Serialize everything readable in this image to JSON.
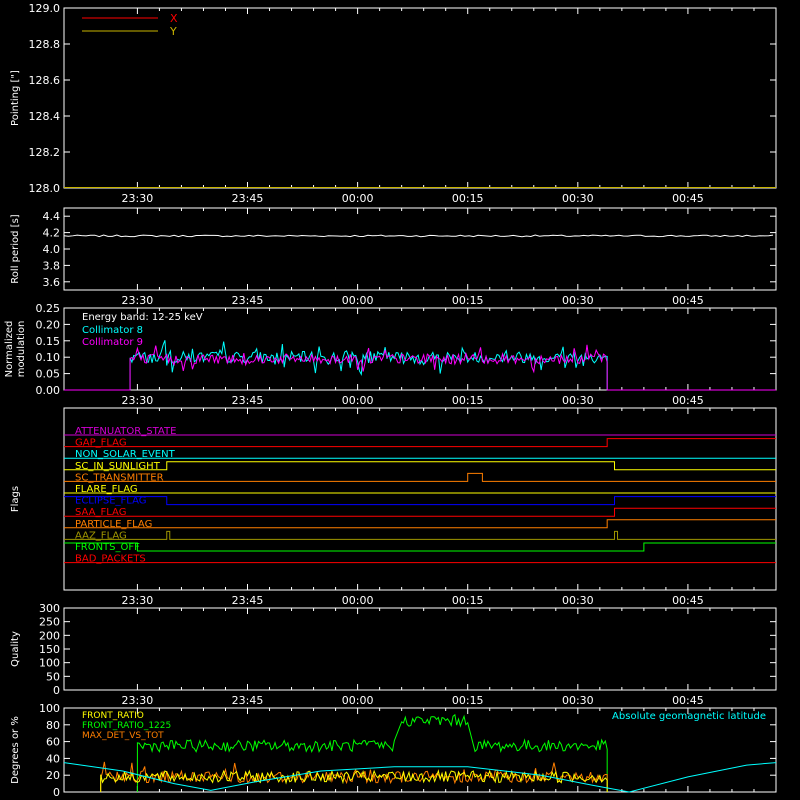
{
  "time_ticks": [
    "23:30",
    "23:45",
    "00:00",
    "00:15",
    "00:30",
    "00:45"
  ],
  "chart_data": [
    {
      "panel": "pointing",
      "type": "line",
      "ylabel": "Pointing [\"]",
      "ylim": [
        128.0,
        129.0
      ],
      "yticks": [
        "128.0",
        "128.2",
        "128.4",
        "128.6",
        "128.8",
        "129.0"
      ],
      "legend": [
        {
          "label": "X",
          "color": "#ff0000"
        },
        {
          "label": "Y",
          "color": "#c8b400"
        }
      ],
      "series": [
        {
          "name": "X",
          "color": "#ff0000",
          "points": [
            [
              "23:20",
              128.0
            ],
            [
              "00:57",
              128.0
            ]
          ]
        },
        {
          "name": "Y",
          "color": "#c8b400",
          "points": [
            [
              "23:20",
              128.0
            ],
            [
              "00:57",
              128.0
            ]
          ]
        }
      ]
    },
    {
      "panel": "roll",
      "type": "line",
      "ylabel": "Roll period [s]",
      "ylim": [
        3.5,
        4.5
      ],
      "yticks": [
        "3.6",
        "3.8",
        "4.0",
        "4.2",
        "4.4"
      ],
      "series": [
        {
          "color": "#ffffff",
          "points": [
            [
              "23:20",
              4.16
            ],
            [
              "23:40",
              4.15
            ],
            [
              "00:00",
              4.16
            ],
            [
              "00:20",
              4.16
            ],
            [
              "00:40",
              4.16
            ],
            [
              "00:57",
              4.16
            ]
          ]
        }
      ]
    },
    {
      "panel": "modulation",
      "type": "line",
      "ylabel": "Normalized modulation",
      "ylim": [
        0.0,
        0.25
      ],
      "yticks": [
        "0.00",
        "0.05",
        "0.10",
        "0.15",
        "0.20",
        "0.25"
      ],
      "annotation": "Energy band: 12-25 keV",
      "legend": [
        {
          "label": "Collimator 8",
          "color": "#00ffff"
        },
        {
          "label": "Collimator 9",
          "color": "#ff00ff"
        }
      ],
      "active_interval": [
        "23:29",
        "00:34"
      ],
      "series": [
        {
          "name": "Collimator 8",
          "color": "#00ffff",
          "mean": 0.1,
          "spread": 0.035
        },
        {
          "name": "Collimator 9",
          "color": "#ff00ff",
          "mean": 0.095,
          "spread": 0.03
        }
      ]
    },
    {
      "panel": "flags",
      "type": "line",
      "ylabel": "Flags",
      "flags": [
        {
          "label": "ATTENUATOR_STATE",
          "color": "#d200d2",
          "transitions": []
        },
        {
          "label": "GAP_FLAG",
          "color": "#ff0000",
          "transitions": [
            [
              "00:34",
              1
            ]
          ]
        },
        {
          "label": "NON_SOLAR_EVENT",
          "color": "#00ffff",
          "transitions": []
        },
        {
          "label": "SC_IN_SUNLIGHT",
          "color": "#ffff00",
          "transitions": [
            [
              "23:34",
              1
            ],
            [
              "00:35",
              0
            ]
          ]
        },
        {
          "label": "SC_TRANSMITTER",
          "color": "#ff7f00",
          "transitions": [
            [
              "00:15",
              1
            ],
            [
              "00:17",
              0
            ]
          ]
        },
        {
          "label": "FLARE_FLAG",
          "color": "#ffff00",
          "transitions": []
        },
        {
          "label": "ECLIPSE_FLAG",
          "color": "#0000ff",
          "initial": 1,
          "transitions": [
            [
              "23:34",
              0
            ],
            [
              "00:35",
              1
            ]
          ]
        },
        {
          "label": "SAA_FLAG",
          "color": "#ff0000",
          "transitions": [
            [
              "00:35",
              1
            ]
          ]
        },
        {
          "label": "PARTICLE_FLAG",
          "color": "#ff7f00",
          "transitions": [
            [
              "00:34",
              1
            ]
          ]
        },
        {
          "label": "AAZ_FLAG",
          "color": "#a09600",
          "transitions": [
            [
              "23:34",
              1
            ],
            [
              "23:34.5",
              0
            ],
            [
              "00:35",
              1
            ],
            [
              "00:35.5",
              0
            ]
          ]
        },
        {
          "label": "FRONTS_OFF",
          "color": "#00ff00",
          "initial": 1,
          "transitions": [
            [
              "23:30",
              0
            ],
            [
              "00:39",
              1
            ]
          ]
        },
        {
          "label": "BAD_PACKETS",
          "color": "#ff0000",
          "transitions": []
        }
      ]
    },
    {
      "panel": "quality",
      "type": "line",
      "ylabel": "Quality",
      "ylim": [
        0,
        300
      ],
      "yticks": [
        "0",
        "50",
        "100",
        "150",
        "200",
        "250",
        "300"
      ],
      "series": []
    },
    {
      "panel": "ratios",
      "type": "line",
      "ylabel": "Degrees or %",
      "ylim": [
        0,
        100
      ],
      "yticks": [
        "0",
        "20",
        "40",
        "60",
        "80",
        "100"
      ],
      "legend": [
        {
          "label": "FRONT_RATIO",
          "color": "#ffff00"
        },
        {
          "label": "FRONT_RATIO_1225",
          "color": "#00ff00"
        },
        {
          "label": "MAX_DET_VS_TOT",
          "color": "#ff7f00"
        }
      ],
      "right_label": {
        "text": "Absolute geomagnetic latitude",
        "color": "#00ffff"
      },
      "series": [
        {
          "name": "FRONT_RATIO_1225",
          "color": "#00ff00",
          "segments": [
            [
              "23:30",
              "00:05",
              55
            ],
            [
              "00:06",
              "00:15",
              85
            ],
            [
              "00:16",
              "00:34",
              55
            ]
          ]
        },
        {
          "name": "MAX_DET_VS_TOT",
          "color": "#ff7f00",
          "segments": [
            [
              "23:25",
              "00:34",
              18
            ]
          ]
        },
        {
          "name": "FRONT_RATIO",
          "color": "#ffff00",
          "segments": [
            [
              "23:25",
              "00:34",
              18
            ]
          ]
        },
        {
          "name": "Absolute geomagnetic latitude",
          "color": "#00ffff",
          "points": [
            [
              "23:20",
              35
            ],
            [
              "23:28",
              25
            ],
            [
              "23:35",
              10
            ],
            [
              "23:40",
              2
            ],
            [
              "23:46",
              12
            ],
            [
              "23:55",
              25
            ],
            [
              "00:05",
              30
            ],
            [
              "00:15",
              30
            ],
            [
              "00:25",
              20
            ],
            [
              "00:32",
              8
            ],
            [
              "00:37",
              0
            ],
            [
              "00:45",
              18
            ],
            [
              "00:53",
              32
            ],
            [
              "00:57",
              35
            ]
          ]
        }
      ]
    }
  ]
}
